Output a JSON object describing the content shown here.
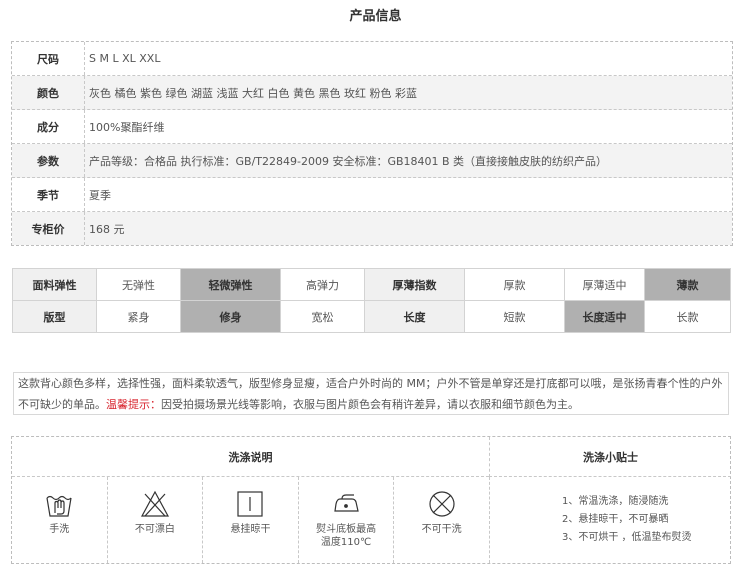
{
  "title": "产品信息",
  "info_rows": [
    {
      "label": "尺码",
      "value": "S  M  L  XL  XXL"
    },
    {
      "label": "颜色",
      "value": "灰色  橘色  紫色  绿色  湖蓝  浅蓝  大红  白色  黄色  黑色  玫红  粉色  彩蓝"
    },
    {
      "label": "成分",
      "value": "100%聚酯纤维"
    },
    {
      "label": "参数",
      "value": "产品等级：合格品    执行标准：GB/T22849-2009    安全标准：GB18401 B 类（直接接触皮肤的纺织产品）"
    },
    {
      "label": "季节",
      "value": "夏季"
    },
    {
      "label": "专柜价",
      "value": "168 元"
    }
  ],
  "fabric": {
    "row1": [
      "面料弹性",
      "无弹性",
      "轻微弹性",
      "高弹力",
      "厚薄指数",
      "厚款",
      "厚薄适中",
      "薄款"
    ],
    "row2": [
      "版型",
      "紧身",
      "修身",
      "宽松",
      "长度",
      "短款",
      "长度适中",
      "长款"
    ]
  },
  "description": {
    "text": "这款背心颜色多样，选择性强，面料柔软透气，版型修身显瘦，适合户外时尚的 MM；户外不管是单穿还是打底都可以哦，是张扬青春个性的户外不可缺少的单品。",
    "warn_label": "温馨提示：",
    "warn_text": "因受拍摄场景光线等影响，衣服与图片颜色会有稍许差异，请以衣服和细节颜色为主。"
  },
  "wash": {
    "header": "洗涤说明",
    "tips_header": "洗涤小贴士",
    "icons": [
      {
        "icon": "hand-wash-icon",
        "label": "手洗"
      },
      {
        "icon": "no-bleach-icon",
        "label": "不可漂白"
      },
      {
        "icon": "hang-dry-icon",
        "label": "悬挂晾干"
      },
      {
        "icon": "iron-icon",
        "label": "熨斗底板最高",
        "label2": "温度110℃"
      },
      {
        "icon": "no-dry-clean-icon",
        "label": "不可干洗"
      }
    ],
    "tips": [
      "1、常温洗涤，随浸随洗",
      "2、悬挂晾干，不可暴晒",
      "3、不可烘干 ，低温垫布熨烫"
    ]
  },
  "colors": {
    "highlight": "#b0b0b0",
    "warn": "#d8262f",
    "header_bg": "#f0f0f0"
  }
}
